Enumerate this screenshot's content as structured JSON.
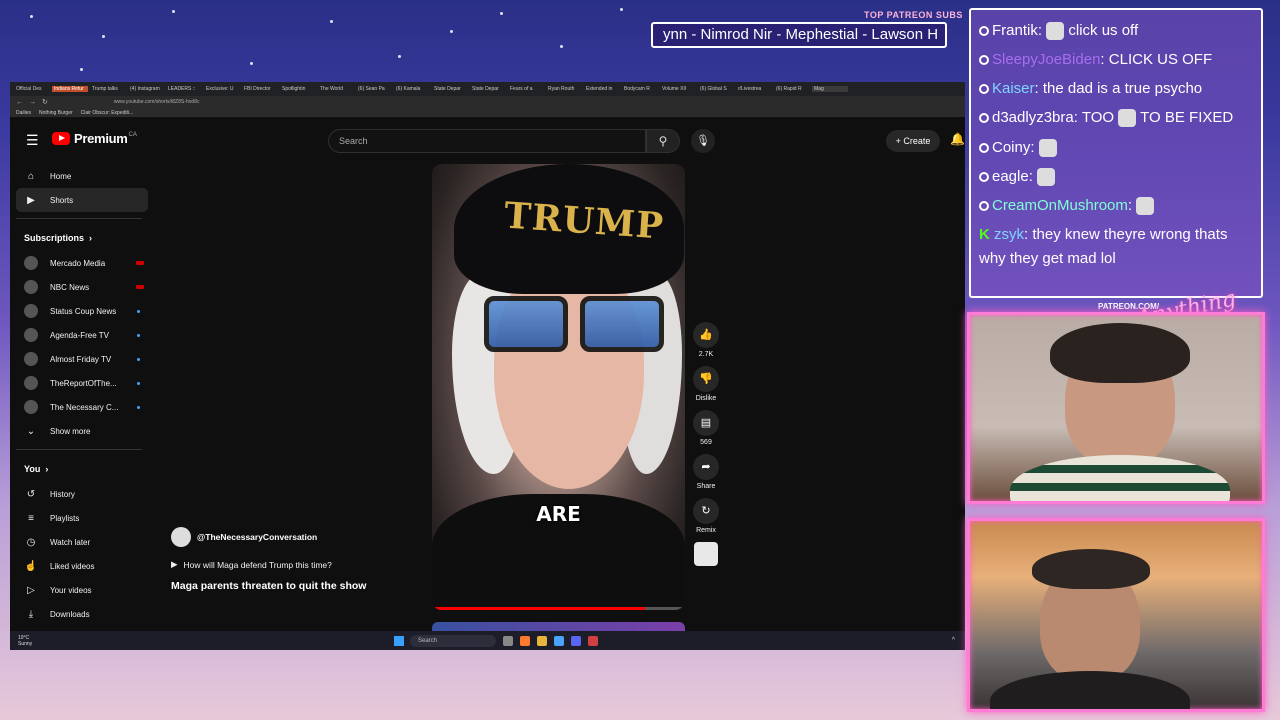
{
  "overlay": {
    "patreon_header": "TOP PATREON SUBS",
    "ticker_text": "ynn - Nimrod Nir - Mephestial - Lawson H",
    "patreon_url": "PATREON.COM/",
    "brand_script": "Anything Else"
  },
  "browser": {
    "tabs": [
      "Official Des",
      "Indians Retur",
      "Trump talks",
      "(4) Instagram",
      "LEADERS ::",
      "Exclusive: U",
      "FBI Director",
      "Spotlightin",
      "The World",
      "(6) Sean Pa",
      "(6) Kamala",
      "State Depar",
      "State Depar",
      "Fears of a",
      "Ryan Routh",
      "Extended in",
      "Bodycam R",
      "Volume XII",
      "(6) Global S",
      "r/Livestrea",
      "(6) Rapid R",
      "Mag"
    ],
    "url": "www.youtube.com/shorts/t8Z8S-hod8c",
    "bookmarks": [
      "Dailies",
      "Nothing Burger",
      "Clair Obscur: Expediti..."
    ]
  },
  "youtube": {
    "logo_text": "Premium",
    "region": "CA",
    "search_placeholder": "Search",
    "create_label": "Create",
    "nav": [
      {
        "label": "Home",
        "icon": "home-icon",
        "active": false
      },
      {
        "label": "Shorts",
        "icon": "shorts-icon",
        "active": true
      }
    ],
    "subscriptions_header": "Subscriptions",
    "subscriptions": [
      {
        "name": "Mercado Media",
        "indicator": "live"
      },
      {
        "name": "NBC News",
        "indicator": "live"
      },
      {
        "name": "Status Coup News",
        "indicator": "dot"
      },
      {
        "name": "Agenda-Free TV",
        "indicator": "dot"
      },
      {
        "name": "Almost Friday TV",
        "indicator": "dot"
      },
      {
        "name": "TheReportOfThe...",
        "indicator": "dot"
      },
      {
        "name": "The Necessary C...",
        "indicator": "dot"
      }
    ],
    "show_more": "Show more",
    "you_header": "You",
    "you_items": [
      {
        "label": "History",
        "icon": "history-icon"
      },
      {
        "label": "Playlists",
        "icon": "playlists-icon"
      },
      {
        "label": "Watch later",
        "icon": "watch-later-icon"
      },
      {
        "label": "Liked videos",
        "icon": "like-icon"
      },
      {
        "label": "Your videos",
        "icon": "your-videos-icon"
      },
      {
        "label": "Downloads",
        "icon": "download-icon"
      }
    ],
    "short": {
      "hat_text": "TRUMP",
      "caption": "ARE",
      "progress": 0.84,
      "channel": "@TheNecessaryConversation",
      "tagline": "How will Maga defend Trump this time?",
      "title": "Maga parents threaten to quit the show"
    },
    "actions": {
      "likes": "2.7K",
      "dislike_label": "Dislike",
      "comments": "569",
      "share_label": "Share",
      "remix_label": "Remix"
    }
  },
  "taskbar": {
    "weather_temp": "19°C",
    "weather_desc": "Sunny",
    "search_placeholder": "Search"
  },
  "chat": {
    "messages": [
      {
        "user": "Frantik",
        "color": "#ffffff",
        "text": "click us off",
        "emote_before": true,
        "badge": true
      },
      {
        "user": "SleepyJoeBiden",
        "color": "#a56ff0",
        "text": "CLICK US OFF",
        "badge": true
      },
      {
        "user": "Kaiser",
        "color": "#7fd6ff",
        "text": "the dad is a true psycho",
        "badge": true
      },
      {
        "user": "d3adlyz3bra",
        "color": "#ffffff",
        "text": "TOO",
        "text_after": "TO BE FIXED",
        "badge": true
      },
      {
        "user": "Coiny",
        "color": "#ffffff",
        "text": "",
        "badge": true
      },
      {
        "user": "eagle",
        "color": "#ffffff",
        "text": "",
        "badge": true
      },
      {
        "user": "CreamOnMushroom",
        "color": "#7fffd4",
        "text": "",
        "badge": true
      },
      {
        "user": "zsyk",
        "color": "#7fd6ff",
        "text": "they knew theyre wrong thats why they get mad lol",
        "badge": false
      }
    ]
  }
}
